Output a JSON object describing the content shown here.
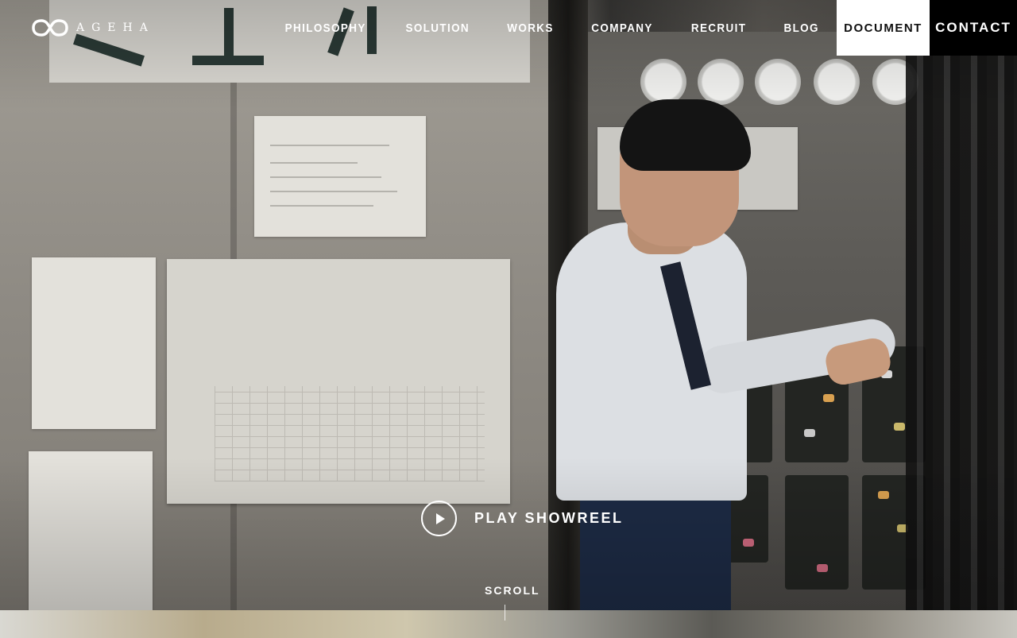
{
  "brand": {
    "logo_text": "AGEHA"
  },
  "nav": {
    "items": [
      {
        "label": "PHILOSOPHY"
      },
      {
        "label": "SOLUTION"
      },
      {
        "label": "WORKS"
      },
      {
        "label": "COMPANY"
      },
      {
        "label": "RECRUIT"
      },
      {
        "label": "BLOG"
      }
    ],
    "document_label": "DOCUMENT",
    "contact_label": "CONTACT"
  },
  "hero": {
    "play_label": "PLAY SHOWREEL",
    "scroll_label": "SCROLL",
    "play_icon": "play-icon"
  },
  "colors": {
    "document_bg": "#ffffff",
    "contact_bg": "#000000",
    "text": "#ffffff"
  }
}
